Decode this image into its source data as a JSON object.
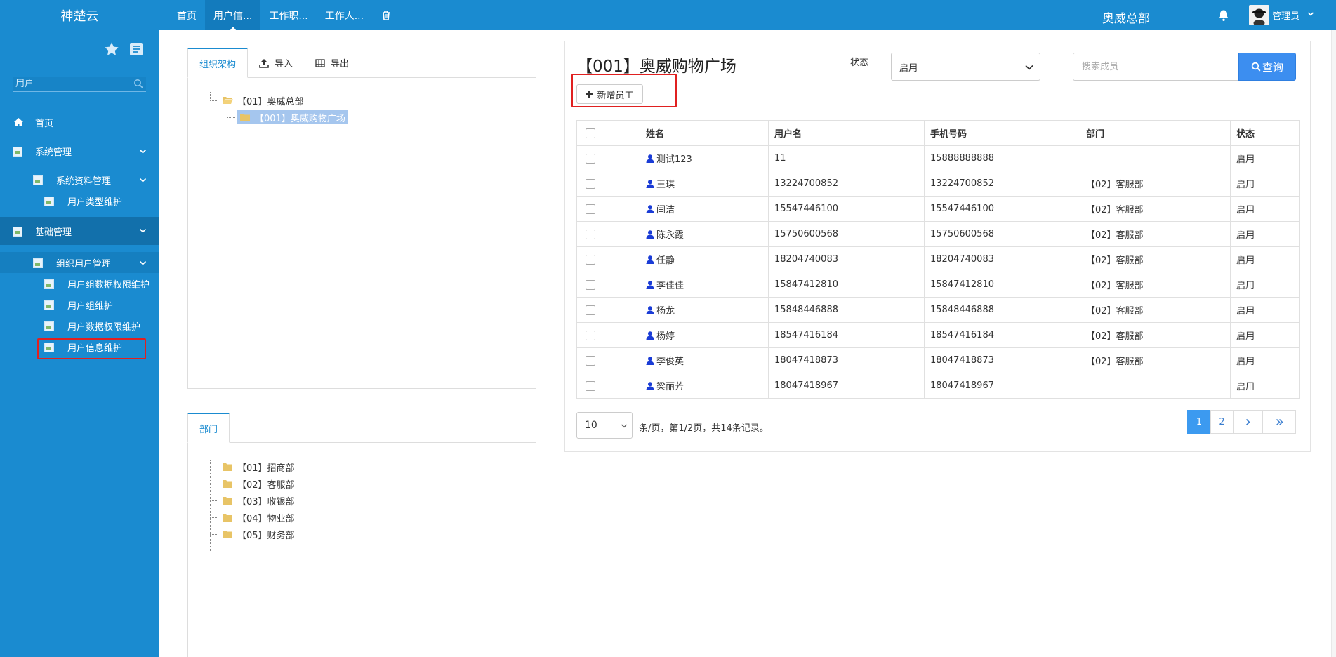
{
  "topbar": {
    "brand": "神楚云",
    "tabs": [
      {
        "label": "首页",
        "active": false
      },
      {
        "label": "用户信...",
        "active": true
      },
      {
        "label": "工作职...",
        "active": false
      },
      {
        "label": "工作人...",
        "active": false
      }
    ],
    "org": "奥威总部",
    "user": "管理员",
    "icons": [
      "trash-icon",
      "bell-icon",
      "avatar",
      "chevron-down-icon"
    ]
  },
  "sidebar": {
    "search_placeholder": "用户",
    "items": [
      {
        "label": "首页",
        "level": 0
      },
      {
        "label": "系统管理",
        "level": 0
      },
      {
        "label": "系统资料管理",
        "level": 1
      },
      {
        "label": "用户类型维护",
        "level": 2
      },
      {
        "label": "基础管理",
        "level": 0
      },
      {
        "label": "组织用户管理",
        "level": 1
      },
      {
        "label": "用户组数据权限维护",
        "level": 2
      },
      {
        "label": "用户组维护",
        "level": 2
      },
      {
        "label": "用户数据权限维护",
        "level": 2
      },
      {
        "label": "用户信息维护",
        "level": 2
      }
    ]
  },
  "org_panel": {
    "tabs": [
      "组织架构",
      "导入",
      "导出"
    ],
    "tree": [
      {
        "label": "【01】奥威总部"
      },
      {
        "label": "【001】奥威购物广场",
        "selected": true
      }
    ]
  },
  "dept_panel": {
    "tab": "部门",
    "tree": [
      "【01】招商部",
      "【02】客服部",
      "【03】收银部",
      "【04】物业部",
      "【05】财务部"
    ]
  },
  "main": {
    "title": "【001】奥威购物广场",
    "status_label": "状态",
    "status_value": "启用",
    "search_placeholder": "搜索成员",
    "search_button": "查询",
    "add_button": "新增员工",
    "columns": [
      "姓名",
      "用户名",
      "手机号码",
      "部门",
      "状态"
    ],
    "rows": [
      [
        "测试123",
        "11",
        "15888888888",
        "",
        "启用"
      ],
      [
        "王琪",
        "13224700852",
        "13224700852",
        "【02】客服部",
        "启用"
      ],
      [
        "闫洁",
        "15547446100",
        "15547446100",
        "【02】客服部",
        "启用"
      ],
      [
        "陈永霞",
        "15750600568",
        "15750600568",
        "【02】客服部",
        "启用"
      ],
      [
        "任静",
        "18204740083",
        "18204740083",
        "【02】客服部",
        "启用"
      ],
      [
        "李佳佳",
        "15847412810",
        "15847412810",
        "【02】客服部",
        "启用"
      ],
      [
        "杨龙",
        "15848446888",
        "15848446888",
        "【02】客服部",
        "启用"
      ],
      [
        "杨婷",
        "18547416184",
        "18547416184",
        "【02】客服部",
        "启用"
      ],
      [
        "李俊英",
        "18047418873",
        "18047418873",
        "【02】客服部",
        "启用"
      ],
      [
        "梁丽芳",
        "18047418967",
        "18047418967",
        "",
        "启用"
      ]
    ],
    "page_size": "10",
    "page_info": "条/页，第1/2页，共14条记录。",
    "pages": [
      "1",
      "2"
    ],
    "accent": "#1a8bd0",
    "highlight": "#e02020"
  }
}
